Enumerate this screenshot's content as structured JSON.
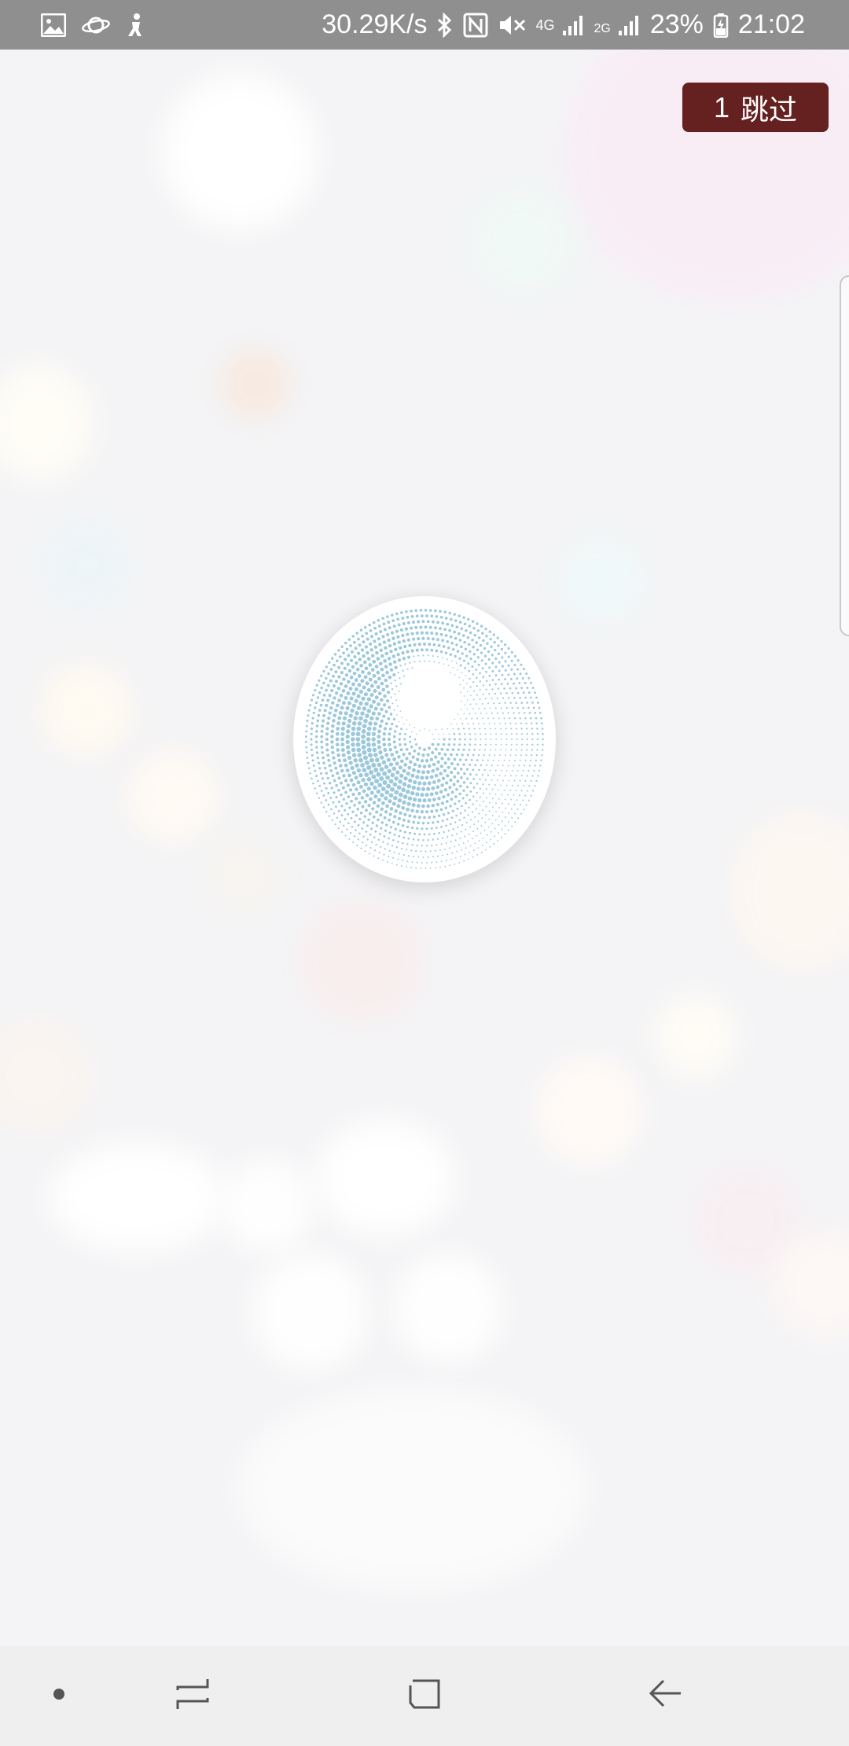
{
  "status_bar": {
    "speed": "30.29K/s",
    "network_4g": "4G",
    "network_2g": "2G",
    "battery": "23%",
    "time": "21:02",
    "icons": [
      "gallery-icon",
      "planet-icon",
      "figure-icon",
      "bluetooth-icon",
      "nfc-icon",
      "mute-icon",
      "signal-icon",
      "signal-icon",
      "battery-charging-icon"
    ]
  },
  "skip": {
    "count": "1",
    "label": "跳过"
  },
  "nav": {
    "icons": [
      "dot-icon",
      "recent-apps-icon",
      "home-icon",
      "back-icon"
    ]
  },
  "colors": {
    "skip_bg": "#652020",
    "status_bar_bg": "#8f8f8f",
    "logo_dots": "#9cc8dc",
    "nav_bar_bg": "#efefef"
  }
}
